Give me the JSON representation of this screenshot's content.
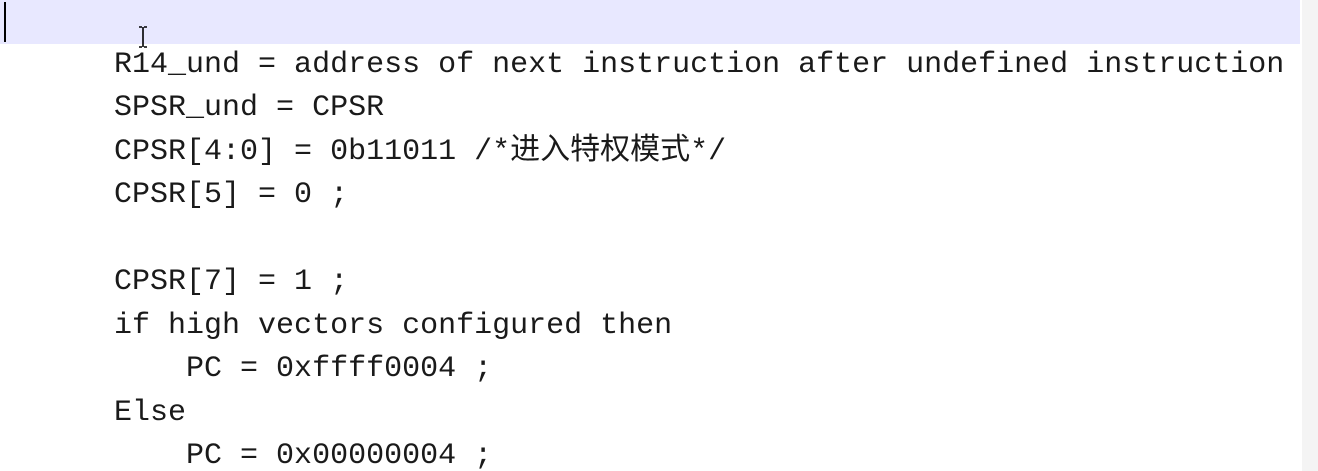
{
  "editor": {
    "lines": [
      "R14_und = address of next instruction after undefined instruction",
      "SPSR_und = CPSR",
      "CPSR[4:0] = 0b11011 /*进入特权模式*/",
      "CPSR[5] = 0 ;",
      "",
      "CPSR[7] = 1 ;",
      "if high vectors configured then",
      "    PC = 0xffff0004 ;",
      "Else",
      "    PC = 0x00000004 ;"
    ],
    "current_line_color": "#e8e8ff",
    "text_color": "#1a1a1a",
    "background": "#ffffff"
  }
}
